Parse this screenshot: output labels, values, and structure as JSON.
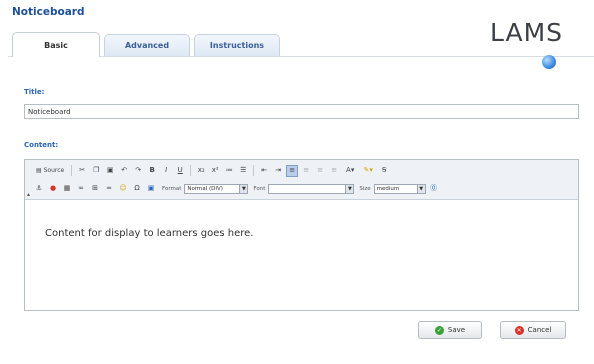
{
  "app": {
    "title": "Noticeboard",
    "logo_text": "LAMS"
  },
  "tabs": [
    {
      "label": "Basic",
      "active": true
    },
    {
      "label": "Advanced",
      "active": false
    },
    {
      "label": "Instructions",
      "active": false
    }
  ],
  "help": {
    "icon": "help-icon"
  },
  "form": {
    "title_label": "Title:",
    "title_value": "Noticeboard",
    "content_label": "Content:"
  },
  "toolbar": {
    "source_label": "Source",
    "format_label": "Format",
    "format_value": "Normal (DIV)",
    "font_label": "Font",
    "font_value": "",
    "size_label": "Size",
    "size_value": "medium"
  },
  "editor": {
    "body_text": "Content for display to learners goes here."
  },
  "actions": {
    "save_label": "Save",
    "cancel_label": "Cancel"
  },
  "colors": {
    "accent": "#2a67b8",
    "save": "#3aa338",
    "cancel": "#d9312b"
  }
}
